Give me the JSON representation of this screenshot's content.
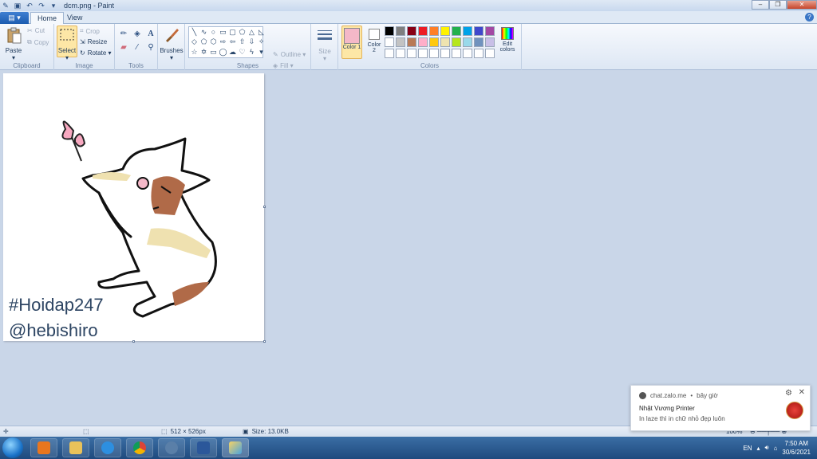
{
  "titlebar": {
    "title": "dcm.png - Paint"
  },
  "tabs": {
    "file": "▤ ▾",
    "home": "Home",
    "view": "View",
    "help": "?"
  },
  "ribbon": {
    "clipboard": {
      "label": "Clipboard",
      "paste": "Paste",
      "cut": "Cut",
      "copy": "Copy"
    },
    "image": {
      "label": "Image",
      "select": "Select",
      "crop": "Crop",
      "resize": "Resize",
      "rotate": "Rotate ▾"
    },
    "tools": {
      "label": "Tools"
    },
    "brushes": {
      "label": "Brushes"
    },
    "shapes": {
      "label": "Shapes",
      "outline": "Outline ▾",
      "fill": "Fill ▾"
    },
    "size": {
      "label": "Size"
    },
    "colors": {
      "label": "Colors",
      "color1_label": "Color 1",
      "color2_label": "Color 2",
      "edit_label": "Edit colors",
      "color1_value": "#f4b8c8",
      "palette": [
        "#000000",
        "#7f7f7f",
        "#880015",
        "#ed1c24",
        "#ff7f27",
        "#fff200",
        "#22b14c",
        "#00a2e8",
        "#3f48cc",
        "#a349a4",
        "#ffffff",
        "#c3c3c3",
        "#b97a57",
        "#ffaec9",
        "#ffc90e",
        "#efe4b0",
        "#b5e61d",
        "#99d9ea",
        "#7092be",
        "#c8bfe7",
        "#ffffff",
        "#ffffff",
        "#ffffff",
        "#ffffff",
        "#ffffff",
        "#ffffff",
        "#ffffff",
        "#ffffff",
        "#ffffff",
        "#ffffff"
      ]
    }
  },
  "canvas": {
    "line1": "#Hoidap247",
    "line2": "@hebishiro"
  },
  "statusbar": {
    "dimensions": "512 × 526px",
    "size": "Size: 13.0KB",
    "zoom": "100%"
  },
  "notification": {
    "source": "chat.zalo.me",
    "time": "bây giờ",
    "title": "Nhật Vương Printer",
    "body": "In laze thì in chữ nhỏ đẹp luôn"
  },
  "tray": {
    "lang": "EN",
    "time": "7:50 AM",
    "date": "30/6/2021"
  }
}
